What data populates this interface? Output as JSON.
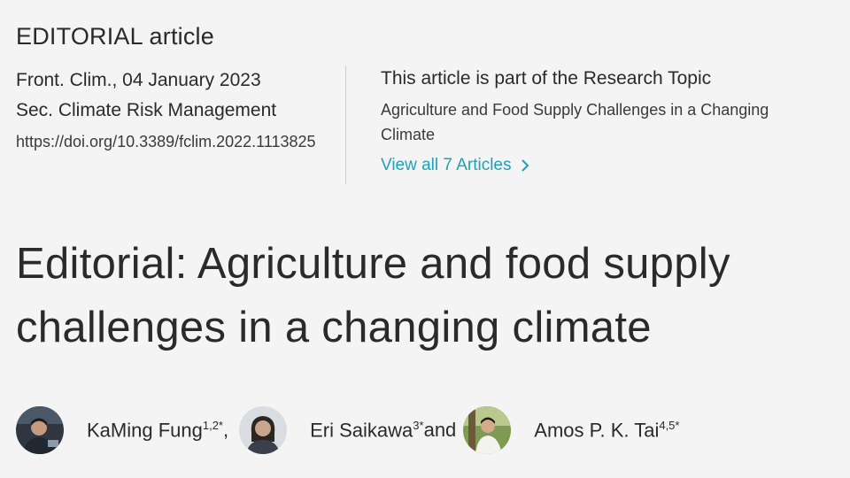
{
  "article_type": "EDITORIAL article",
  "journal_line": "Front. Clim., 04 January 2023",
  "section_line": "Sec. Climate Risk Management",
  "doi": "https://doi.org/10.3389/fclim.2022.1113825",
  "research_topic": {
    "heading": "This article is part of the Research Topic",
    "title": "Agriculture and Food Supply Challenges in a Changing Climate",
    "link_label": "View all 7 Articles"
  },
  "title_line1": "Editorial: Agriculture and food supply",
  "title_line2": "challenges in a changing climate",
  "authors": [
    {
      "name": "KaMing Fung",
      "affil": "1,2*",
      "after": ","
    },
    {
      "name": "Eri Saikawa",
      "affil": "3*",
      "after": " and"
    },
    {
      "name": "Amos P. K. Tai",
      "affil": "4,5*",
      "after": ""
    }
  ],
  "colors": {
    "accent": "#1fa1b8",
    "text": "#2a2a2a",
    "background": "#f4f4f4"
  },
  "icons": {
    "link_arrow": "chevron-right-icon"
  }
}
